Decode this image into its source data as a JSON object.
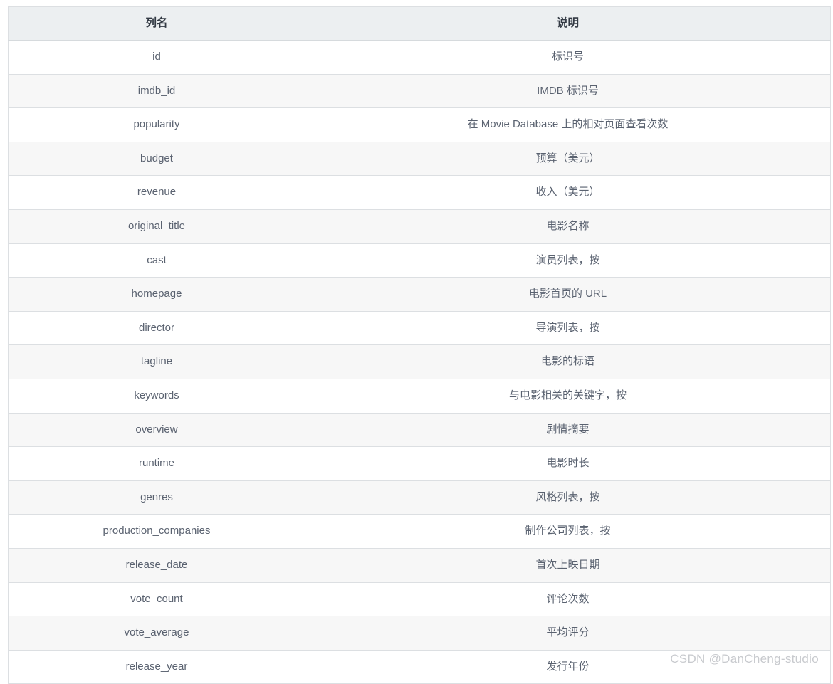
{
  "table": {
    "headers": {
      "name": "列名",
      "description": "说明"
    },
    "rows": [
      {
        "name": "id",
        "description": "标识号"
      },
      {
        "name": "imdb_id",
        "description": "IMDB 标识号"
      },
      {
        "name": "popularity",
        "description": "在 Movie Database 上的相对页面查看次数"
      },
      {
        "name": "budget",
        "description": "预算（美元）"
      },
      {
        "name": "revenue",
        "description": "收入（美元）"
      },
      {
        "name": "original_title",
        "description": "电影名称"
      },
      {
        "name": "cast",
        "description": "演员列表，按"
      },
      {
        "name": "homepage",
        "description": "电影首页的 URL"
      },
      {
        "name": "director",
        "description": "导演列表，按"
      },
      {
        "name": "tagline",
        "description": "电影的标语"
      },
      {
        "name": "keywords",
        "description": "与电影相关的关键字，按"
      },
      {
        "name": "overview",
        "description": "剧情摘要"
      },
      {
        "name": "runtime",
        "description": "电影时长"
      },
      {
        "name": "genres",
        "description": "风格列表，按"
      },
      {
        "name": "production_companies",
        "description": "制作公司列表，按"
      },
      {
        "name": "release_date",
        "description": "首次上映日期"
      },
      {
        "name": "vote_count",
        "description": "评论次数"
      },
      {
        "name": "vote_average",
        "description": "平均评分"
      },
      {
        "name": "release_year",
        "description": "发行年份"
      }
    ]
  },
  "watermark": {
    "text": "CSDN @DanCheng-studio"
  },
  "colors": {
    "header_background": "#eceff1",
    "header_text": "#333a44",
    "body_text": "#5a6270",
    "row_alt_background": "#f7f7f7",
    "border": "#dcdfe2",
    "watermark_text": "#c8cace"
  }
}
